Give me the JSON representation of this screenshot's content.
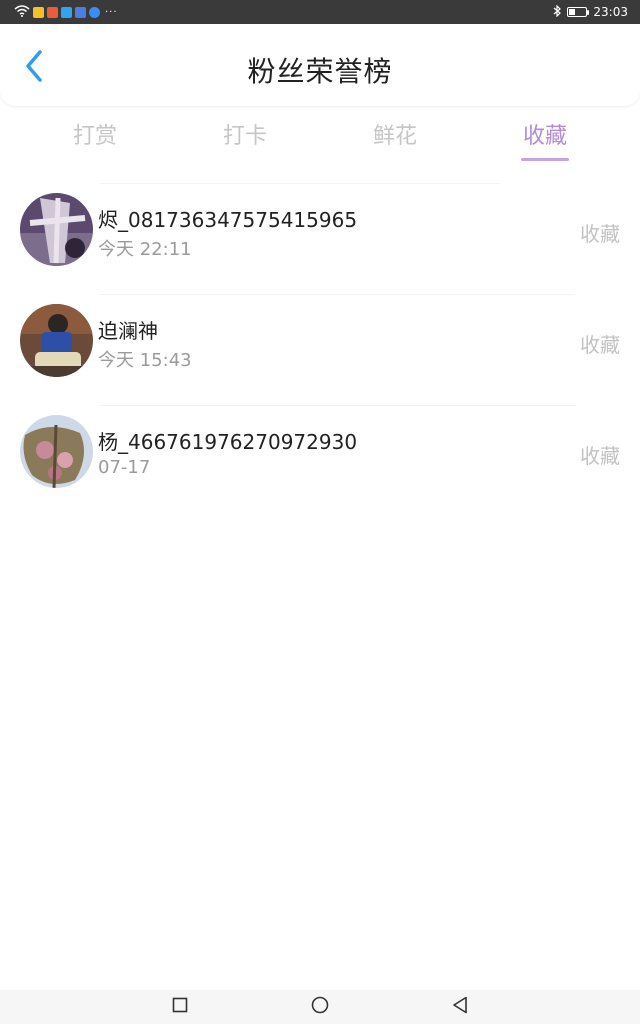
{
  "status_bar": {
    "time": "23:03",
    "battery_percent": 30,
    "icons": [
      "wifi-icon",
      "app-icon",
      "app-icon",
      "app-icon",
      "app-icon",
      "app-icon",
      "more-icon",
      "bluetooth-icon",
      "battery-icon"
    ],
    "more": "···"
  },
  "header": {
    "title": "粉丝荣誉榜"
  },
  "tabs": [
    {
      "label": "打赏",
      "active": false
    },
    {
      "label": "打卡",
      "active": false
    },
    {
      "label": "鲜花",
      "active": false
    },
    {
      "label": "收藏",
      "active": true
    }
  ],
  "list": [
    {
      "name": "烬_081736347575415965",
      "time": "今天 22:11",
      "action": "收藏",
      "avatar": "avatar-image"
    },
    {
      "name": "迫澜神",
      "time": "今天 15:43",
      "action": "收藏",
      "avatar": "avatar-image"
    },
    {
      "name": "杨_466761976270972930",
      "time": "07-17",
      "action": "收藏",
      "avatar": "avatar-image"
    }
  ],
  "colors": {
    "accent": "#b58bd4",
    "back_icon": "#2f9ee8",
    "status_bar_bg": "#3a3a3a"
  }
}
